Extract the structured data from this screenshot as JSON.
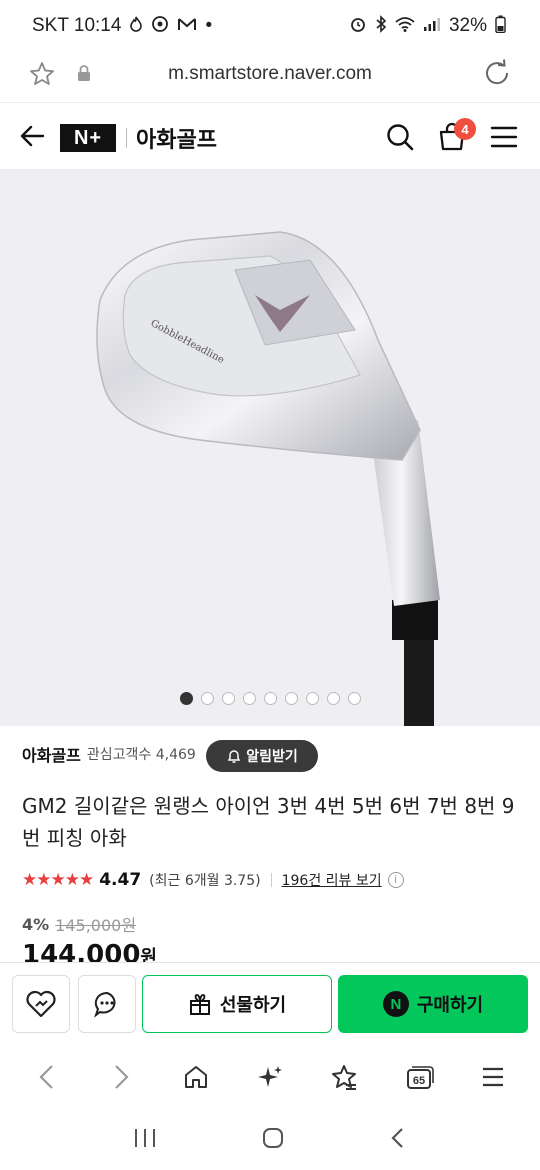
{
  "status_bar": {
    "carrier_time": "SKT 10:14",
    "left_icons": [
      "flame-icon",
      "sync-icon",
      "gmail-icon"
    ],
    "dot": "•",
    "battery": "32%"
  },
  "url_bar": {
    "url": "m.smartstore.naver.com"
  },
  "header": {
    "logo": "N+",
    "store_name": "아화골프",
    "cart_count": "4"
  },
  "gallery": {
    "current_index": 1,
    "total": 9
  },
  "store": {
    "name": "아화골프",
    "followers": "관심고객수 4,469",
    "alarm_label": "알림받기"
  },
  "product": {
    "title": "GM2 길이같은 원랭스 아이언 3번 4번 5번 6번 7번 8번 9번 피칭 아화",
    "stars": "★★★★★",
    "rating": "4.47",
    "rating_recent": "(최근 6개월 3.75)",
    "review_link": "196건 리뷰 보기",
    "discount": "4%",
    "original_price": "145,000원",
    "price": "144,000",
    "price_unit": "원"
  },
  "actions": {
    "gift_label": "선물하기",
    "buy_label": "구매하기",
    "npay_mark": "N"
  },
  "browser_nav": {
    "tabs_count": "65"
  },
  "colors": {
    "naver_green": "#03c75a",
    "badge_red": "#f04e3e",
    "star_red": "#e64040"
  }
}
